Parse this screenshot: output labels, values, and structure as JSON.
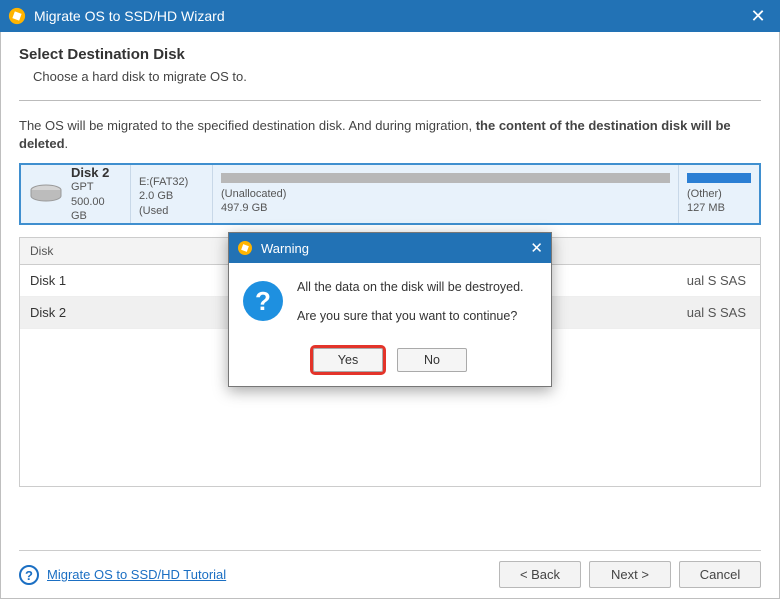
{
  "titlebar": {
    "title": "Migrate OS to SSD/HD Wizard"
  },
  "section": {
    "heading": "Select Destination Disk",
    "sub": "Choose a hard disk to migrate OS to."
  },
  "warning_line": {
    "pre": "The OS will be migrated to the specified destination disk. And during migration, ",
    "bold": "the content of the destination disk will be deleted",
    "post": "."
  },
  "selected_disk": {
    "name": "Disk 2",
    "scheme": "GPT",
    "capacity": "500.00 GB",
    "parts": [
      {
        "label": "E:(FAT32)",
        "size": "2.0 GB (Used"
      },
      {
        "label": "(Unallocated)",
        "size": "497.9 GB"
      },
      {
        "label": "(Other)",
        "size": "127 MB"
      }
    ]
  },
  "table": {
    "header": "Disk",
    "rows": [
      {
        "name": "Disk 1",
        "note": "ual S SAS"
      },
      {
        "name": "Disk 2",
        "note": "ual S SAS"
      }
    ]
  },
  "footer": {
    "help": "Migrate OS to SSD/HD Tutorial",
    "back": "< Back",
    "next": "Next >",
    "cancel": "Cancel"
  },
  "modal": {
    "title": "Warning",
    "line1": "All the data on the disk will be destroyed.",
    "line2": "Are you sure that you want to continue?",
    "yes": "Yes",
    "no": "No"
  }
}
